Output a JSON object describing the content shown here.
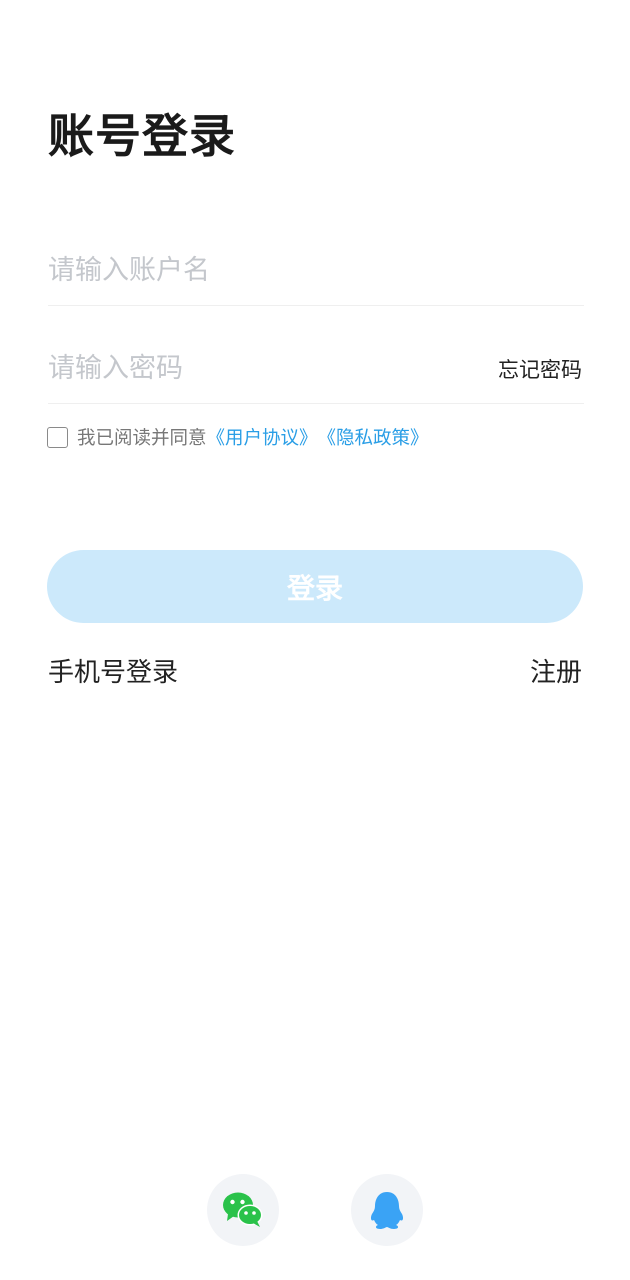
{
  "header": {
    "title": "账号登录"
  },
  "form": {
    "username_placeholder": "请输入账户名",
    "username_value": "",
    "password_placeholder": "请输入密码",
    "password_value": "",
    "forgot_password": "忘记密码"
  },
  "agreement": {
    "checked": false,
    "prefix": "我已阅读并同意",
    "user_agreement": "《用户协议》",
    "privacy_policy": "《隐私政策》"
  },
  "actions": {
    "login_label": "登录",
    "phone_login": "手机号登录",
    "register": "注册"
  },
  "social": [
    {
      "name": "wechat-icon",
      "color": "#2ac24a"
    },
    {
      "name": "qq-icon",
      "color": "#3aa3f5"
    }
  ],
  "colors": {
    "link": "#2a9ee6",
    "login_button_disabled": "#cce9fb",
    "placeholder": "#c4c7cc",
    "social_bg": "#f2f4f7"
  }
}
